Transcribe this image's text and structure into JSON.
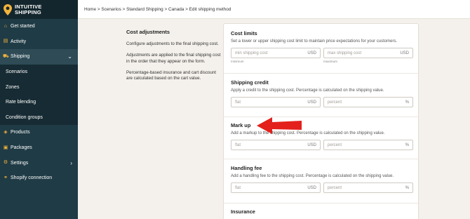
{
  "brand": {
    "line1": "INTUITIVE",
    "line2": "SHIPPING"
  },
  "sidebar": {
    "items": [
      {
        "label": "Get started",
        "icon": "home-icon",
        "glyph": "⌂"
      },
      {
        "label": "Activity",
        "icon": "list-icon",
        "glyph": "▤"
      },
      {
        "label": "Shipping",
        "icon": "truck-icon",
        "glyph": "⛟",
        "expanded": true
      },
      {
        "label": "Scenarios",
        "sub": true
      },
      {
        "label": "Zones",
        "sub": true
      },
      {
        "label": "Rate blending",
        "sub": true
      },
      {
        "label": "Condition groups",
        "sub": true
      },
      {
        "label": "Products",
        "icon": "tag-icon",
        "glyph": "◈"
      },
      {
        "label": "Packages",
        "icon": "package-icon",
        "glyph": "▣"
      },
      {
        "label": "Settings",
        "icon": "gear-icon",
        "glyph": "⚙"
      },
      {
        "label": "Shopify connection",
        "icon": "link-icon",
        "glyph": "⚭"
      }
    ]
  },
  "breadcrumb": {
    "items": [
      "Home",
      "Scenarios",
      "Standard Shipping",
      "Canada",
      "Edit shipping method"
    ],
    "separator": ">"
  },
  "info": {
    "title": "Cost adjustments",
    "p1": "Configure adjustments to the final shipping cost.",
    "p2": "Adjustments are applied to the final shipping cost in the order that they appear on the form.",
    "p3": "Percentage-based insurance and cart discount are calculated based on the cart value."
  },
  "cost_limits": {
    "title": "Cost limits",
    "desc": "Set a lower or upper shipping cost limit to maintain price expectations for your customers.",
    "min_placeholder": "min shipping cost",
    "min_unit": "USD",
    "min_hint": "minimum",
    "max_placeholder": "max shipping cost",
    "max_unit": "USD",
    "max_hint": "maximum"
  },
  "shipping_credit": {
    "title": "Shipping credit",
    "desc": "Apply a credit to the shipping cost. Percentage is calculated on the shipping value.",
    "flat_placeholder": "flat",
    "flat_unit": "USD",
    "percent_placeholder": "percent",
    "percent_unit": "%"
  },
  "mark_up": {
    "title": "Mark up",
    "desc": "Add a markup to the shipping cost. Percentage is calculated on the shipping value.",
    "flat_placeholder": "flat",
    "flat_unit": "USD",
    "percent_placeholder": "percent",
    "percent_unit": "%"
  },
  "handling_fee": {
    "title": "Handling fee",
    "desc": "Add a handling fee to the shipping cost. Percentage is calculated on the shipping value.",
    "flat_placeholder": "flat",
    "flat_unit": "USD",
    "percent_placeholder": "percent",
    "percent_unit": "%"
  },
  "insurance": {
    "title": "Insurance"
  },
  "colors": {
    "sidebar": "#1f3b45",
    "accent": "#f3b43c",
    "arrow": "#e3201b"
  }
}
